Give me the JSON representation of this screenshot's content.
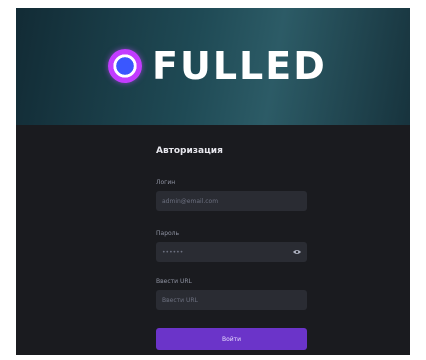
{
  "brand": {
    "name": "FULLED"
  },
  "auth": {
    "title": "Авторизация",
    "login": {
      "label": "Логин",
      "value": "admin@email.com"
    },
    "password": {
      "label": "Пароль",
      "value": "••••••"
    },
    "url": {
      "label": "Ввести URL",
      "placeholder": "Ввести URL"
    },
    "submit_label": "Войти"
  },
  "icons": {
    "logo": "ring-logo-icon",
    "password_toggle": "eye-icon"
  },
  "colors": {
    "accent": "#6b34c9",
    "background": "#1a1b1f",
    "field": "#2a2c33",
    "logo_ring": "#c23cff",
    "logo_core": "#3a57ff"
  }
}
